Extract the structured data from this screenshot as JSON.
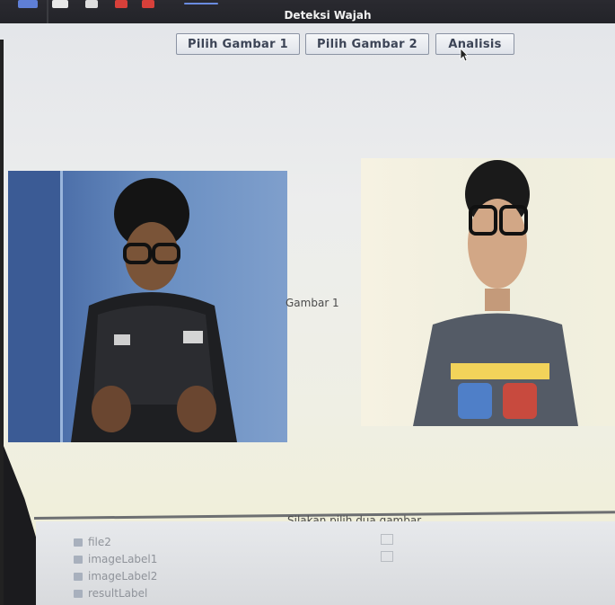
{
  "window": {
    "title": "Deteksi Wajah"
  },
  "toolbar": {
    "buttons": [
      {
        "label": "Pilih Gambar 1"
      },
      {
        "label": "Pilih Gambar 2"
      },
      {
        "label": "Analisis"
      }
    ]
  },
  "images": {
    "label_between": "Gambar 1"
  },
  "status": {
    "text": "Silakan pilih dua gambar."
  },
  "navigator": {
    "items": [
      {
        "name": "file2"
      },
      {
        "name": "imageLabel1"
      },
      {
        "name": "imageLabel2"
      },
      {
        "name": "resultLabel"
      }
    ]
  },
  "colors": {
    "taskbar": "#1e1f24",
    "window_bg": "#eceded",
    "button_text": "#3c4456",
    "photo1_bg": "#5b7fb8",
    "photo2_bg": "#f1eedd"
  }
}
